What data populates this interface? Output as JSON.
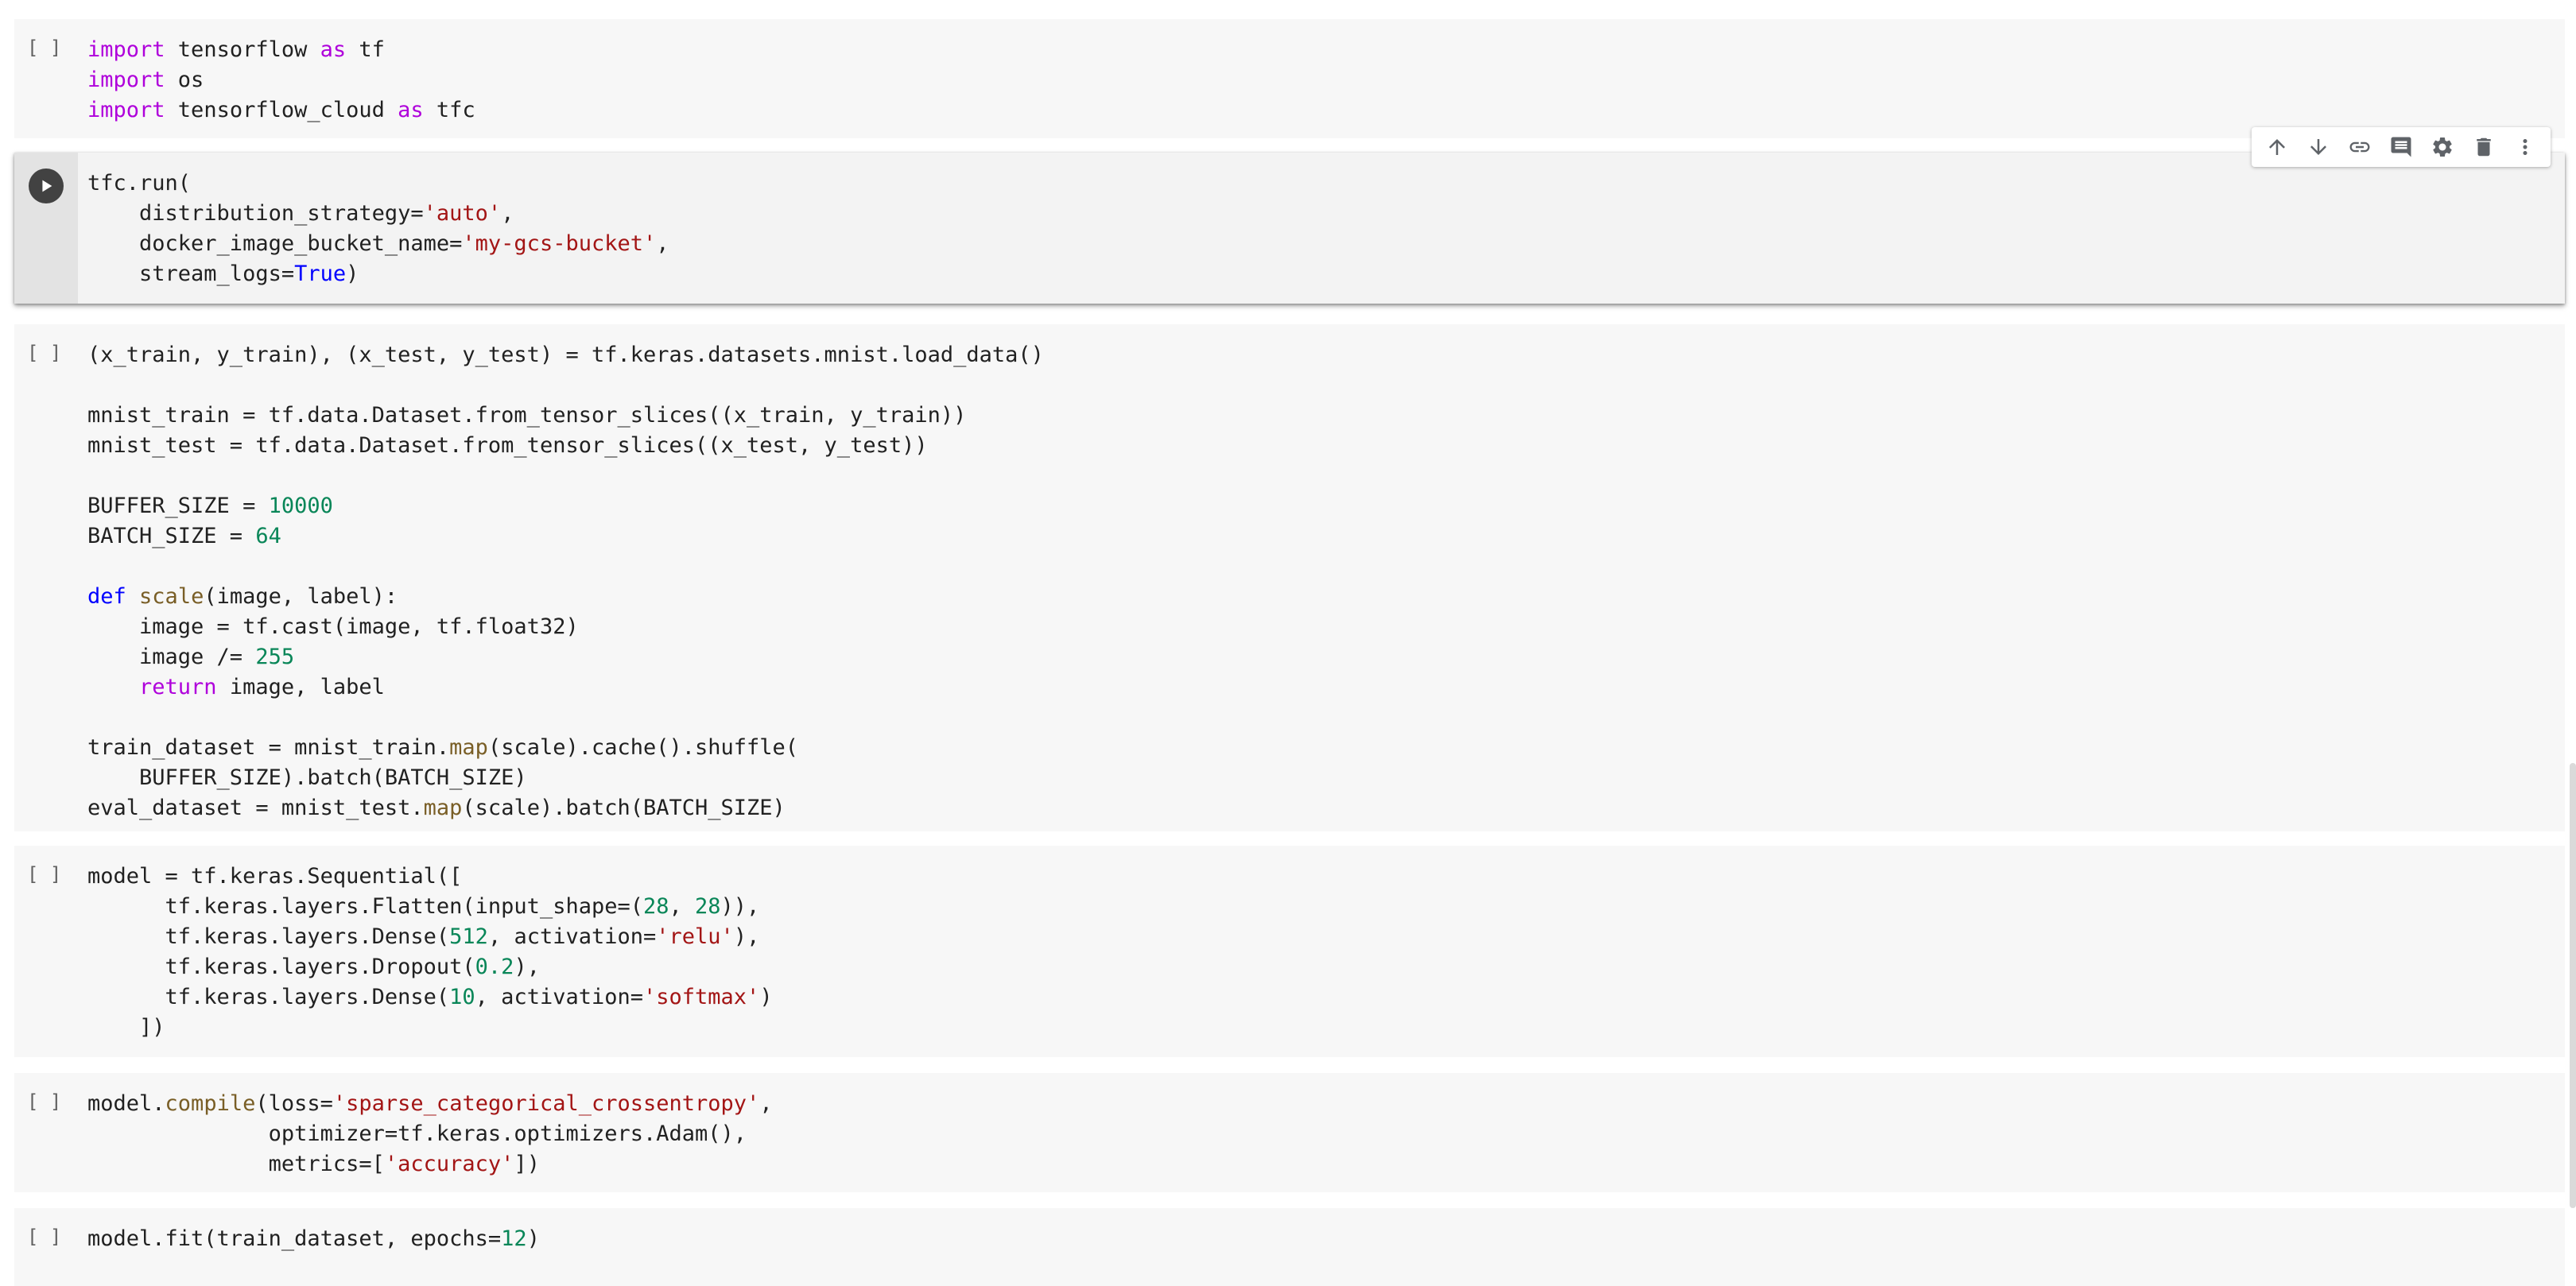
{
  "toolbar": {
    "icons": [
      "arrow-up-icon",
      "arrow-down-icon",
      "link-icon",
      "comment-icon",
      "gear-icon",
      "trash-icon",
      "more-vert-icon"
    ]
  },
  "cells": [
    {
      "id": "cell-imports",
      "bracket": "[ ]",
      "lines": [
        [
          [
            "kw",
            "import"
          ],
          [
            "p",
            " tensorflow "
          ],
          [
            "kw",
            "as"
          ],
          [
            "p",
            " tf"
          ]
        ],
        [
          [
            "kw",
            "import"
          ],
          [
            "p",
            " os"
          ]
        ],
        [
          [
            "kw",
            "import"
          ],
          [
            "p",
            " tensorflow_cloud "
          ],
          [
            "kw",
            "as"
          ],
          [
            "p",
            " tfc"
          ]
        ]
      ]
    },
    {
      "id": "cell-tfc-run",
      "bracket": "",
      "active": true,
      "lines": [
        [
          [
            "p",
            "tfc.run("
          ]
        ],
        [
          [
            "p",
            "    distribution_strategy="
          ],
          [
            "str",
            "'auto'"
          ],
          [
            "p",
            ","
          ]
        ],
        [
          [
            "p",
            "    docker_image_bucket_name="
          ],
          [
            "str",
            "'my-gcs-bucket'"
          ],
          [
            "p",
            ","
          ]
        ],
        [
          [
            "p",
            "    stream_logs="
          ],
          [
            "kwb",
            "True"
          ],
          [
            "p",
            ")"
          ]
        ]
      ]
    },
    {
      "id": "cell-dataset",
      "bracket": "[ ]",
      "lines": [
        [
          [
            "p",
            "(x_train, y_train), (x_test, y_test) = tf.keras.datasets.mnist.load_data()"
          ]
        ],
        [
          [
            "p",
            ""
          ]
        ],
        [
          [
            "p",
            "mnist_train = tf.data.Dataset.from_tensor_slices((x_train, y_train))"
          ]
        ],
        [
          [
            "p",
            "mnist_test = tf.data.Dataset.from_tensor_slices((x_test, y_test))"
          ]
        ],
        [
          [
            "p",
            ""
          ]
        ],
        [
          [
            "p",
            "BUFFER_SIZE = "
          ],
          [
            "num",
            "10000"
          ]
        ],
        [
          [
            "p",
            "BATCH_SIZE = "
          ],
          [
            "num",
            "64"
          ]
        ],
        [
          [
            "p",
            ""
          ]
        ],
        [
          [
            "kwb",
            "def"
          ],
          [
            "p",
            " "
          ],
          [
            "fn",
            "scale"
          ],
          [
            "p",
            "(image, label):"
          ]
        ],
        [
          [
            "p",
            "    image = tf.cast(image, tf.float32)"
          ]
        ],
        [
          [
            "p",
            "    image /= "
          ],
          [
            "num",
            "255"
          ]
        ],
        [
          [
            "p",
            "    "
          ],
          [
            "kw",
            "return"
          ],
          [
            "p",
            " image, label"
          ]
        ],
        [
          [
            "p",
            ""
          ]
        ],
        [
          [
            "p",
            "train_dataset = mnist_train."
          ],
          [
            "fn",
            "map"
          ],
          [
            "p",
            "(scale).cache().shuffle("
          ]
        ],
        [
          [
            "p",
            "    BUFFER_SIZE).batch(BATCH_SIZE)"
          ]
        ],
        [
          [
            "p",
            "eval_dataset = mnist_test."
          ],
          [
            "fn",
            "map"
          ],
          [
            "p",
            "(scale).batch(BATCH_SIZE)"
          ]
        ]
      ]
    },
    {
      "id": "cell-model",
      "bracket": "[ ]",
      "lines": [
        [
          [
            "p",
            "model = tf.keras.Sequential(["
          ]
        ],
        [
          [
            "p",
            "      tf.keras.layers.Flatten(input_shape=("
          ],
          [
            "num",
            "28"
          ],
          [
            "p",
            ", "
          ],
          [
            "num",
            "28"
          ],
          [
            "p",
            ")),"
          ]
        ],
        [
          [
            "p",
            "      tf.keras.layers.Dense("
          ],
          [
            "num",
            "512"
          ],
          [
            "p",
            ", activation="
          ],
          [
            "str",
            "'relu'"
          ],
          [
            "p",
            "),"
          ]
        ],
        [
          [
            "p",
            "      tf.keras.layers.Dropout("
          ],
          [
            "num",
            "0.2"
          ],
          [
            "p",
            "),"
          ]
        ],
        [
          [
            "p",
            "      tf.keras.layers.Dense("
          ],
          [
            "num",
            "10"
          ],
          [
            "p",
            ", activation="
          ],
          [
            "str",
            "'softmax'"
          ],
          [
            "p",
            ")"
          ]
        ],
        [
          [
            "p",
            "    ])"
          ]
        ]
      ]
    },
    {
      "id": "cell-compile",
      "bracket": "[ ]",
      "lines": [
        [
          [
            "p",
            "model."
          ],
          [
            "fn",
            "compile"
          ],
          [
            "p",
            "(loss="
          ],
          [
            "str",
            "'sparse_categorical_crossentropy'"
          ],
          [
            "p",
            ","
          ]
        ],
        [
          [
            "p",
            "              optimizer=tf.keras.optimizers.Adam(),"
          ]
        ],
        [
          [
            "p",
            "              metrics=["
          ],
          [
            "str",
            "'accuracy'"
          ],
          [
            "p",
            "])"
          ]
        ]
      ]
    },
    {
      "id": "cell-fit",
      "bracket": "[ ]",
      "lines": [
        [
          [
            "p",
            "model.fit(train_dataset, epochs="
          ],
          [
            "num",
            "12"
          ],
          [
            "p",
            ")"
          ]
        ]
      ]
    }
  ]
}
